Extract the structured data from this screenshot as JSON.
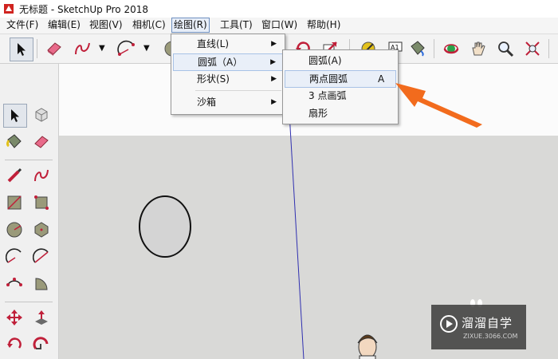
{
  "window": {
    "title": "无标题 - SketchUp Pro 2018"
  },
  "menubar": {
    "items": [
      {
        "label": "文件(F)"
      },
      {
        "label": "编辑(E)"
      },
      {
        "label": "视图(V)"
      },
      {
        "label": "相机(C)"
      },
      {
        "label": "绘图(R)"
      },
      {
        "label": "工具(T)"
      },
      {
        "label": "窗口(W)"
      },
      {
        "label": "帮助(H)"
      }
    ],
    "active": "绘图(R)"
  },
  "draw_menu": {
    "items": [
      {
        "label": "直线(L)"
      },
      {
        "label": "圆弧（A）"
      },
      {
        "label": "形状(S)"
      },
      {
        "label": "沙箱"
      }
    ]
  },
  "arc_submenu": {
    "items": [
      {
        "label": "圆弧(A)",
        "shortcut": ""
      },
      {
        "label": "两点圆弧",
        "shortcut": "A"
      },
      {
        "label": "3 点画弧",
        "shortcut": ""
      },
      {
        "label": "扇形",
        "shortcut": ""
      }
    ],
    "highlighted": "两点圆弧"
  },
  "watermark": {
    "brand": "溜溜自学",
    "url": "ZIXUE.3066.COM"
  },
  "colors": {
    "accent": "#f26b1d",
    "highlight": "#e9eff8",
    "ground": "#d9d9d7"
  }
}
